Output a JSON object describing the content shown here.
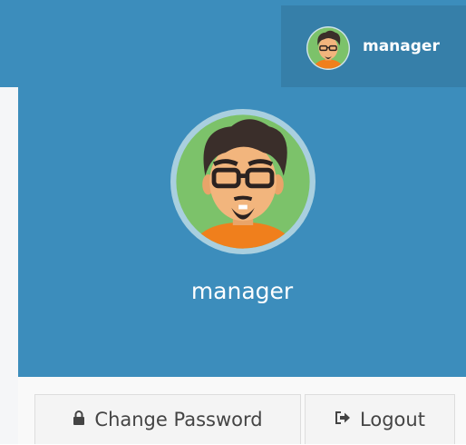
{
  "header": {
    "username": "manager",
    "avatar_icon": "user-avatar-icon",
    "colors": {
      "navbar": "#3c8dbc",
      "navbar_active": "#367fa9"
    }
  },
  "user_panel": {
    "username": "manager",
    "avatar_icon": "user-avatar-icon"
  },
  "footer": {
    "change_password_label": "Change Password",
    "change_password_icon": "lock-icon",
    "logout_label": "Logout",
    "logout_icon": "sign-out-icon"
  }
}
